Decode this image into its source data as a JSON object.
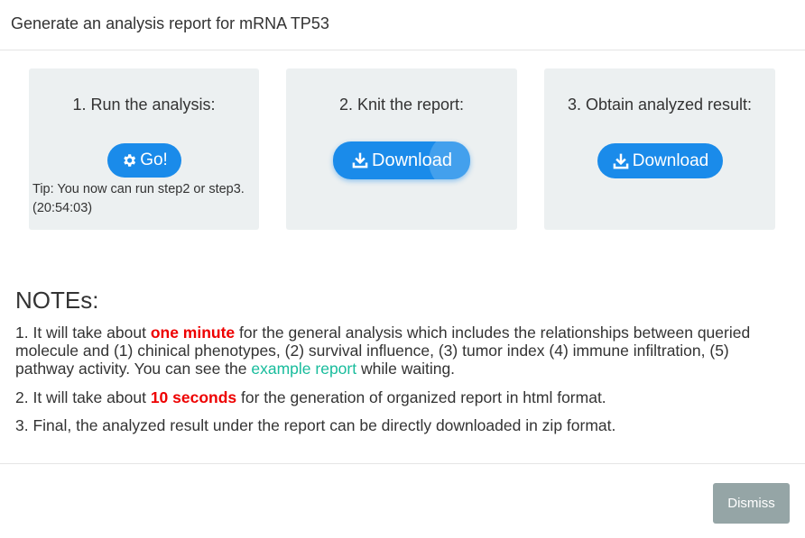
{
  "modal": {
    "title": "Generate an analysis report for mRNA TP53"
  },
  "steps": [
    {
      "title": "1. Run the analysis:",
      "button_label": "Go!",
      "button_icon": "gear-icon",
      "tip": "Tip: You now can run step2 or step3.",
      "tip_time": "(20:54:03)"
    },
    {
      "title": "2. Knit the report:",
      "button_label": "Download",
      "button_icon": "download-icon"
    },
    {
      "title": "3. Obtain analyzed result:",
      "button_label": "Download",
      "button_icon": "download-icon"
    }
  ],
  "notes": {
    "title": "NOTEs:",
    "items": [
      {
        "prefix": "1. It will take about ",
        "highlight": "one minute",
        "middle": " for the general analysis which includes the relationships between queried molecule and (1) chinical phenotypes, (2) survival influence, (3) tumor index (4) immune infiltration, (5) pathway activity. You can see the ",
        "link": "example report",
        "suffix": " while waiting."
      },
      {
        "prefix": "2. It will take about ",
        "highlight": "10 seconds",
        "suffix": " for the generation of organized report in html format."
      },
      {
        "text": "3. Final, the analyzed result under the report can be directly downloaded in zip format."
      }
    ]
  },
  "footer": {
    "dismiss_label": "Dismiss"
  },
  "colors": {
    "primary": "#1a8bea",
    "panel_bg": "#ecf0f1",
    "highlight": "#ee0000",
    "link": "#18bc9c",
    "dismiss_bg": "#95a5a6"
  }
}
